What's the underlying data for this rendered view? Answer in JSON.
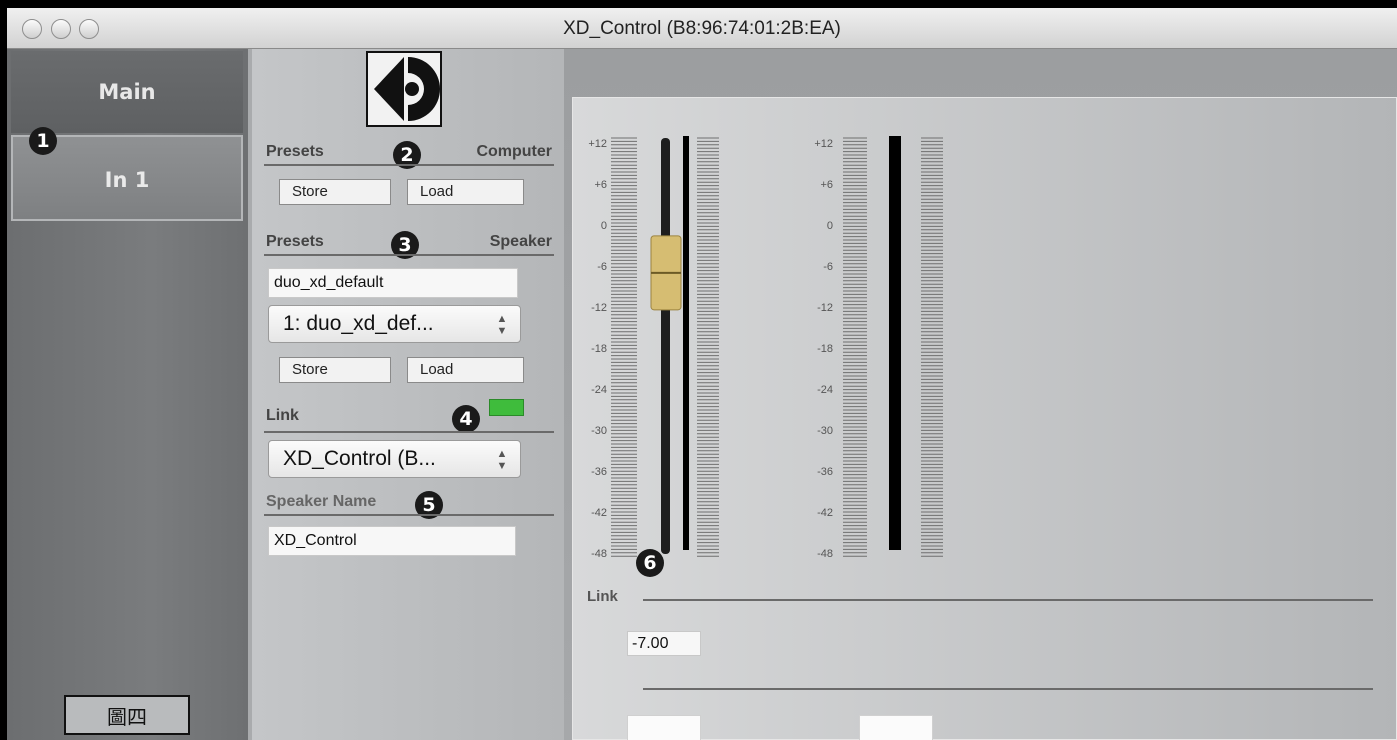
{
  "window": {
    "title": "XD_Control (B8:96:74:01:2B:EA)"
  },
  "sidebar": {
    "tabs": [
      {
        "label": "Main"
      },
      {
        "label": "In 1"
      }
    ],
    "caption": "圖四"
  },
  "annotations": [
    "1",
    "2",
    "3",
    "4",
    "5",
    "6"
  ],
  "presets_computer": {
    "left_label": "Presets",
    "right_label": "Computer",
    "store_label": "Store",
    "load_label": "Load"
  },
  "presets_speaker": {
    "left_label": "Presets",
    "right_label": "Speaker",
    "name_value": "duo_xd_default",
    "selected_preset": "1: duo_xd_def...",
    "store_label": "Store",
    "load_label": "Load"
  },
  "link": {
    "label": "Link",
    "status_color": "#3fbc3c",
    "selected_device": "XD_Control (B..."
  },
  "speaker_name": {
    "label": "Speaker Name",
    "value": "XD_Control"
  },
  "meters": {
    "scale_labels": [
      "+12",
      "+6",
      "0",
      "-6",
      "-12",
      "-18",
      "-24",
      "-30",
      "-36",
      "-42",
      "-48"
    ],
    "fader_value_db": -7.0,
    "link_label": "Link",
    "value_display": "-7.00"
  }
}
